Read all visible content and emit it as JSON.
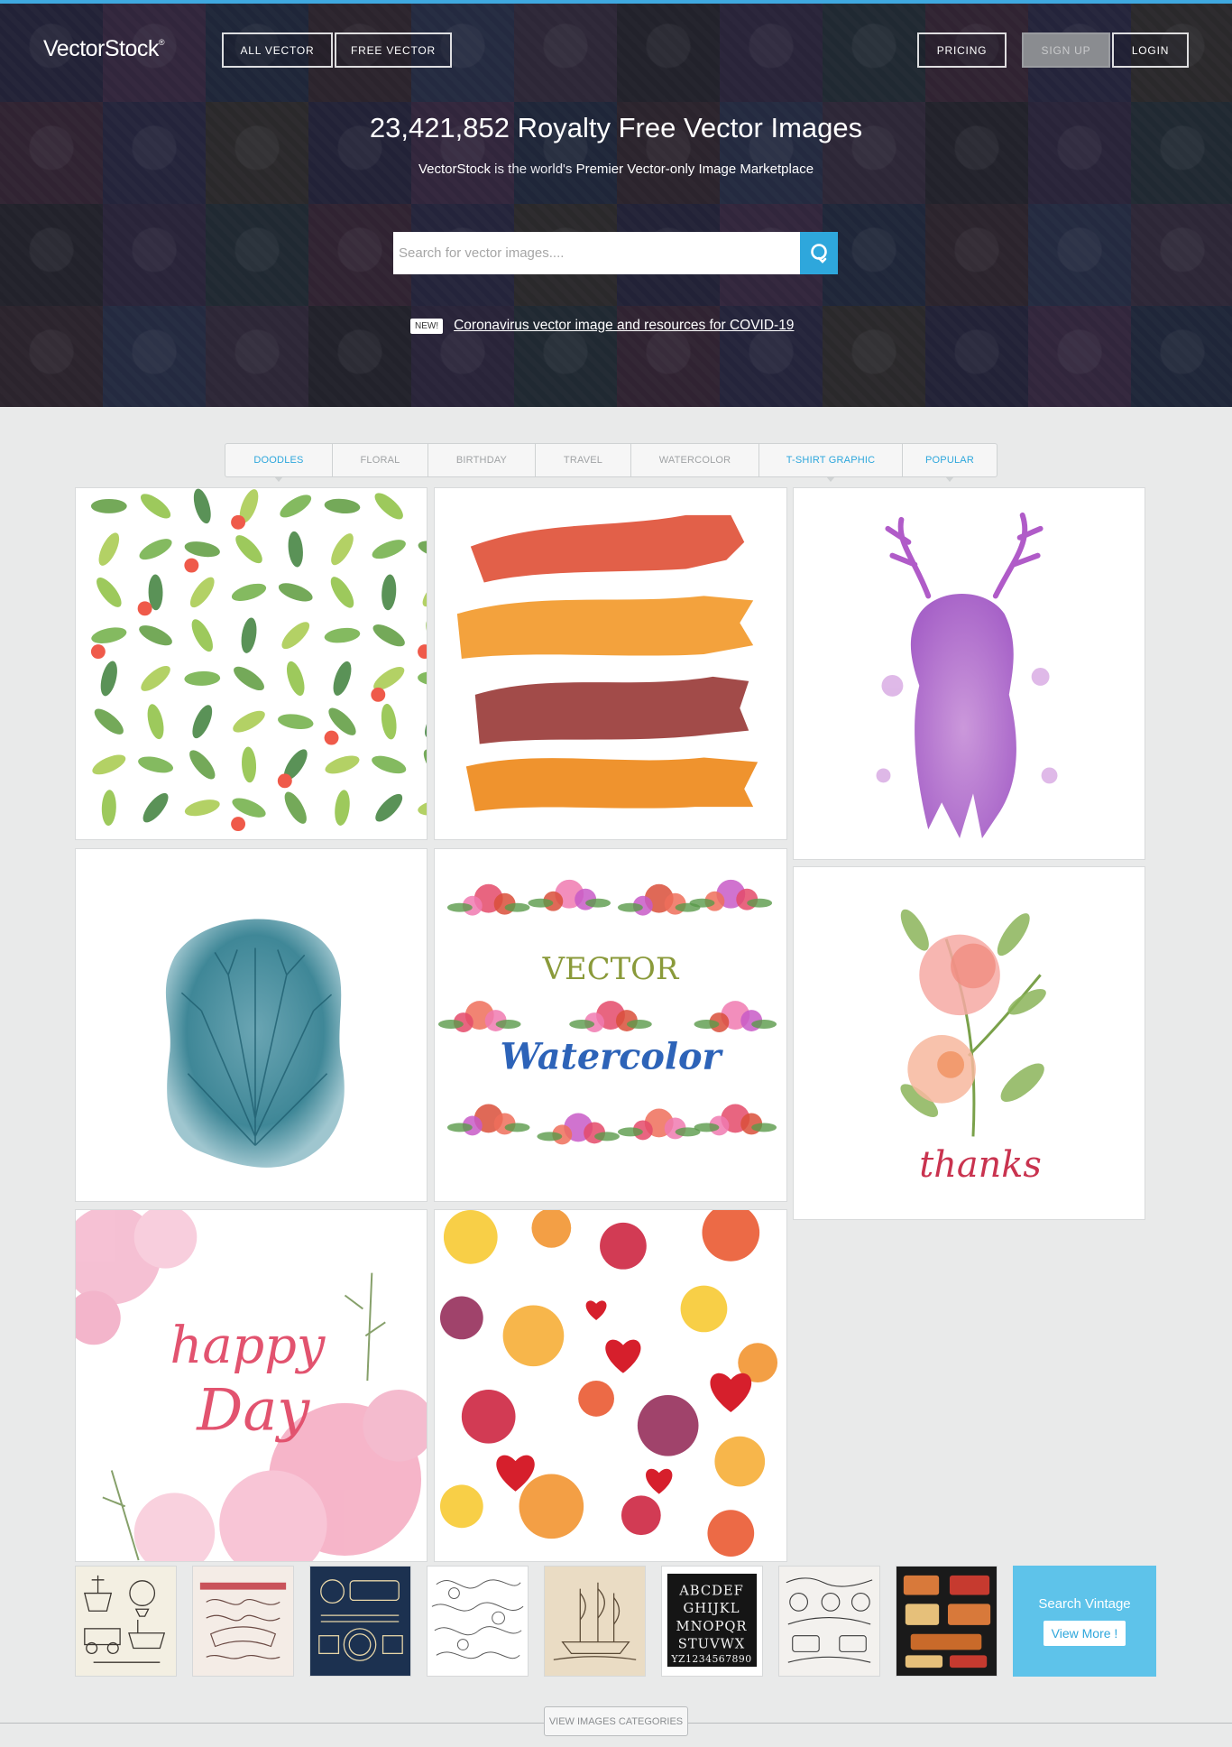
{
  "brand": {
    "logo_text": "VectorStock",
    "logo_mark": "®",
    "accent": "#2ea7dc"
  },
  "nav": {
    "all_vector": "ALL VECTOR",
    "free_vector": "FREE VECTOR",
    "pricing": "PRICING",
    "sign_up": "SIGN UP",
    "login": "LOGIN"
  },
  "hero": {
    "title": "23,421,852 Royalty Free Vector Images",
    "subtitle_brand": "VectorStock",
    "subtitle_mid": " is the world's ",
    "subtitle_strong": "Premier Vector-only Image Marketplace",
    "search_placeholder": "Search for vector images....",
    "search_icon": "search-icon",
    "new_badge": "NEW!",
    "covid_link": "Coronavirus vector image and resources for COVID-19"
  },
  "tabs": [
    {
      "label": "DOODLES",
      "active": true
    },
    {
      "label": "FLORAL"
    },
    {
      "label": "BIRTHDAY"
    },
    {
      "label": "TRAVEL"
    },
    {
      "label": "WATERCOLOR"
    },
    {
      "label": "T-SHIRT GRAPHIC",
      "active": true
    },
    {
      "label": "POPULAR",
      "active": true
    }
  ],
  "gallery": {
    "vector_text": "VECTOR",
    "watercolor_text": "Watercolor",
    "thanks_text": "thanks",
    "happy_text": "happy",
    "day_text": "Day"
  },
  "vintage": {
    "items": [
      "vintage-transport",
      "flourish-ornaments",
      "vintage-labels",
      "floral-engraving",
      "sailing-ship",
      "alphabet",
      "ornament-collection",
      "retro-labels"
    ],
    "alphabet_text": "ABCDEFGHIJKLMNOPQRSTUVWXYZ1234567890",
    "cta_title": "Search Vintage",
    "cta_button": "View More !"
  },
  "footer": {
    "categories_button": "VIEW IMAGES CATEGORIES"
  }
}
